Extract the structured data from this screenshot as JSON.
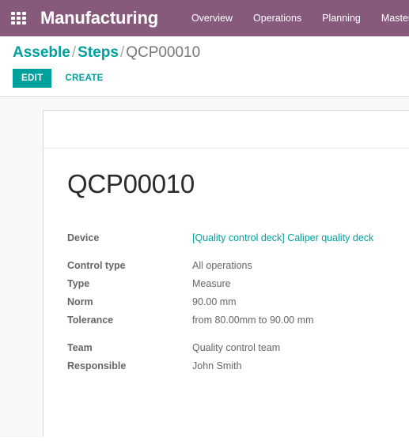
{
  "navbar": {
    "apps_icon": "apps-grid-icon",
    "brand": "Manufacturing",
    "menu": [
      {
        "label": "Overview"
      },
      {
        "label": "Operations"
      },
      {
        "label": "Planning"
      },
      {
        "label": "Master"
      }
    ],
    "background_color": "#875A7B"
  },
  "control_panel": {
    "breadcrumb": {
      "items": [
        {
          "label": "Asseble",
          "type": "link"
        },
        {
          "label": "Steps",
          "type": "link"
        },
        {
          "label": "QCP00010",
          "type": "active"
        }
      ],
      "separator": "/"
    },
    "buttons": {
      "edit_label": "EDIT",
      "create_label": "CREATE"
    },
    "accent_color": "#00A09D"
  },
  "form": {
    "title": "QCP00010",
    "groups": [
      {
        "fields": [
          {
            "label": "Device",
            "value": "[Quality control deck] Caliper quality deck",
            "is_link": true
          }
        ]
      },
      {
        "fields": [
          {
            "label": "Control type",
            "value": "All operations",
            "is_link": false
          },
          {
            "label": "Type",
            "value": "Measure",
            "is_link": false
          },
          {
            "label": "Norm",
            "value": "90.00 mm",
            "is_link": false
          },
          {
            "label": "Tolerance",
            "value": "from 80.00mm to 90.00 mm",
            "is_link": false
          }
        ]
      },
      {
        "fields": [
          {
            "label": "Team",
            "value": "Quality control team",
            "is_link": false
          },
          {
            "label": "Responsible",
            "value": "John Smith",
            "is_link": false
          }
        ]
      }
    ]
  }
}
